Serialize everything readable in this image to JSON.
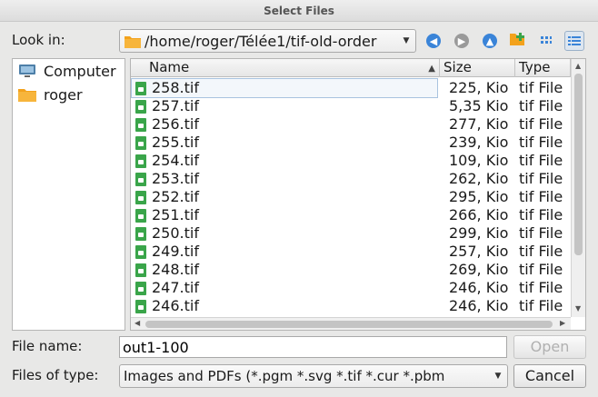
{
  "window": {
    "title": "Select Files"
  },
  "toolbar": {
    "look_in_label": "Look in:",
    "path": "/home/roger/Télée1/tif-old-order",
    "icons": [
      "back-icon",
      "forward-icon",
      "parent-directory-icon",
      "new-folder-icon",
      "list-view-icon",
      "detail-view-icon"
    ]
  },
  "sidebar": {
    "items": [
      {
        "label": "Computer",
        "icon": "computer-icon"
      },
      {
        "label": "roger",
        "icon": "folder-icon"
      }
    ]
  },
  "filelist": {
    "columns": [
      "Name",
      "Size",
      "Type"
    ],
    "sort": {
      "column": "Name",
      "direction": "ascending"
    },
    "rows": [
      {
        "name": "258.tif",
        "size": "225, Kio",
        "type": "tif File"
      },
      {
        "name": "257.tif",
        "size": "5,35 Kio",
        "type": "tif File"
      },
      {
        "name": "256.tif",
        "size": "277, Kio",
        "type": "tif File"
      },
      {
        "name": "255.tif",
        "size": "239, Kio",
        "type": "tif File"
      },
      {
        "name": "254.tif",
        "size": "109, Kio",
        "type": "tif File"
      },
      {
        "name": "253.tif",
        "size": "262, Kio",
        "type": "tif File"
      },
      {
        "name": "252.tif",
        "size": "295, Kio",
        "type": "tif File"
      },
      {
        "name": "251.tif",
        "size": "266, Kio",
        "type": "tif File"
      },
      {
        "name": "250.tif",
        "size": "299, Kio",
        "type": "tif File"
      },
      {
        "name": "249.tif",
        "size": "257, Kio",
        "type": "tif File"
      },
      {
        "name": "248.tif",
        "size": "269, Kio",
        "type": "tif File"
      },
      {
        "name": "247.tif",
        "size": "246, Kio",
        "type": "tif File"
      },
      {
        "name": "246.tif",
        "size": "246, Kio",
        "type": "tif File"
      }
    ]
  },
  "footer": {
    "file_name_label": "File name:",
    "file_name_value": "out1-100",
    "open_label": "Open",
    "files_of_type_label": "Files of type:",
    "files_of_type_value": "Images and PDFs (*.pgm *.svg *.tif *.cur *.pbm",
    "cancel_label": "Cancel"
  },
  "colors": {
    "accent_blue": "#3a84d8",
    "folder_orange": "#f3a21c",
    "file_green": "#3aa54a"
  }
}
